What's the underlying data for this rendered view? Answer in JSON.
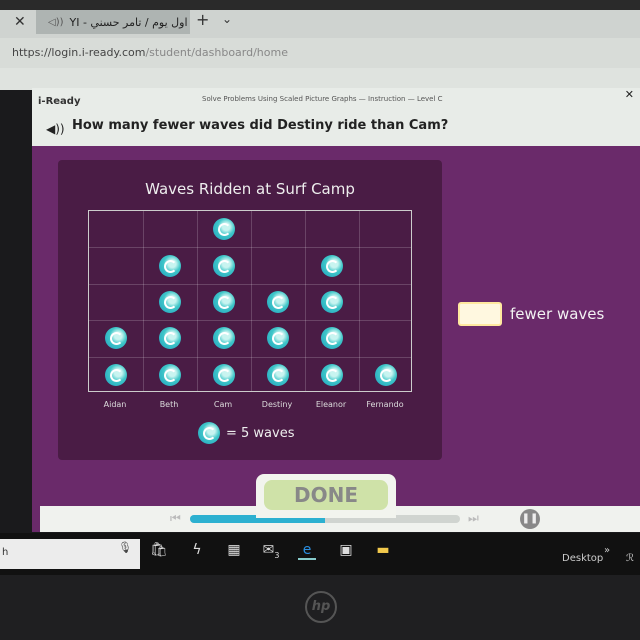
{
  "browser": {
    "tab_title": "اول يوم / تامر حسني - YI",
    "url_host": "https://login.i-ready.com",
    "url_path": "/student/dashboard/home",
    "close_glyph": "✕",
    "new_tab_glyph": "+",
    "tab_menu_glyph": "⌄",
    "speaker_glyph": "◁))"
  },
  "app": {
    "logo": "i-Ready",
    "lesson": "Solve Problems Using Scaled Picture Graphs — Instruction — Level C",
    "close_glyph": "✕",
    "speaker_glyph": "◀))",
    "question": "How many fewer waves did Destiny ride than Cam?",
    "answer_value": "",
    "answer_label": "fewer waves",
    "done_label": "DONE",
    "progress": 0.5,
    "skip_back_glyph": "⏮",
    "skip_fwd_glyph": "⏭",
    "pause_glyph": "❚❚"
  },
  "chart_data": {
    "type": "picture",
    "title": "Waves Ridden at Surf Camp",
    "categories": [
      "Aidan",
      "Beth",
      "Cam",
      "Destiny",
      "Eleanor",
      "Fernando"
    ],
    "icon_counts": [
      2,
      4,
      5,
      3,
      4,
      1
    ],
    "values": [
      10,
      20,
      25,
      15,
      20,
      5
    ],
    "max_icons": 5,
    "key": "= 5 waves",
    "icon": "wave-icon"
  },
  "taskbar": {
    "search_text": "h",
    "mic_glyph": "🎙",
    "mail_badge": "3",
    "desktop_label": "Desktop",
    "chevron_glyph": "»",
    "people_glyph": "ℛ"
  },
  "bezel": {
    "brand": "hp"
  }
}
